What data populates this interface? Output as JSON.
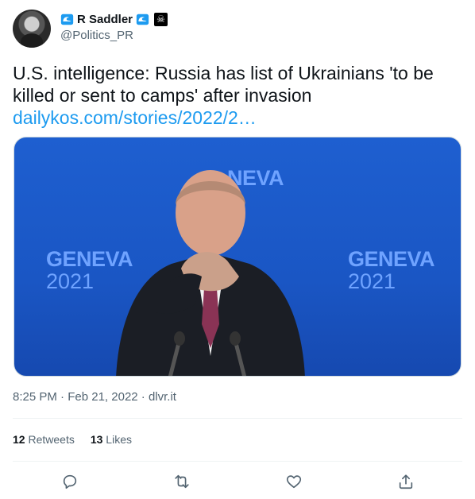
{
  "author": {
    "name": "R Saddler",
    "handle": "@Politics_PR"
  },
  "tweet": {
    "text": "U.S. intelligence: Russia has list of Ukrainians 'to be killed or sent to camps' after invasion",
    "link": "dailykos.com/stories/2022/2…"
  },
  "media": {
    "backdrop_text_left": "GENEVA",
    "backdrop_year_left": "2021",
    "backdrop_text_right": "GENEVA",
    "backdrop_year_right": "2021",
    "backdrop_text_top": "NEVA"
  },
  "meta": {
    "time": "8:25 PM",
    "sep1": " · ",
    "date": "Feb 21, 2022",
    "sep2": " · ",
    "source": "dlvr.it"
  },
  "stats": {
    "retweets_count": "12",
    "retweets_label": "Retweets",
    "likes_count": "13",
    "likes_label": "Likes"
  },
  "icons": [
    "wave-icon",
    "pirate-flag-icon",
    "reply-icon",
    "retweet-icon",
    "like-icon",
    "share-icon"
  ],
  "colors": {
    "link": "#1d9bf0",
    "muted": "#536471",
    "text": "#0f1419",
    "backdrop": "#1a56c4"
  }
}
